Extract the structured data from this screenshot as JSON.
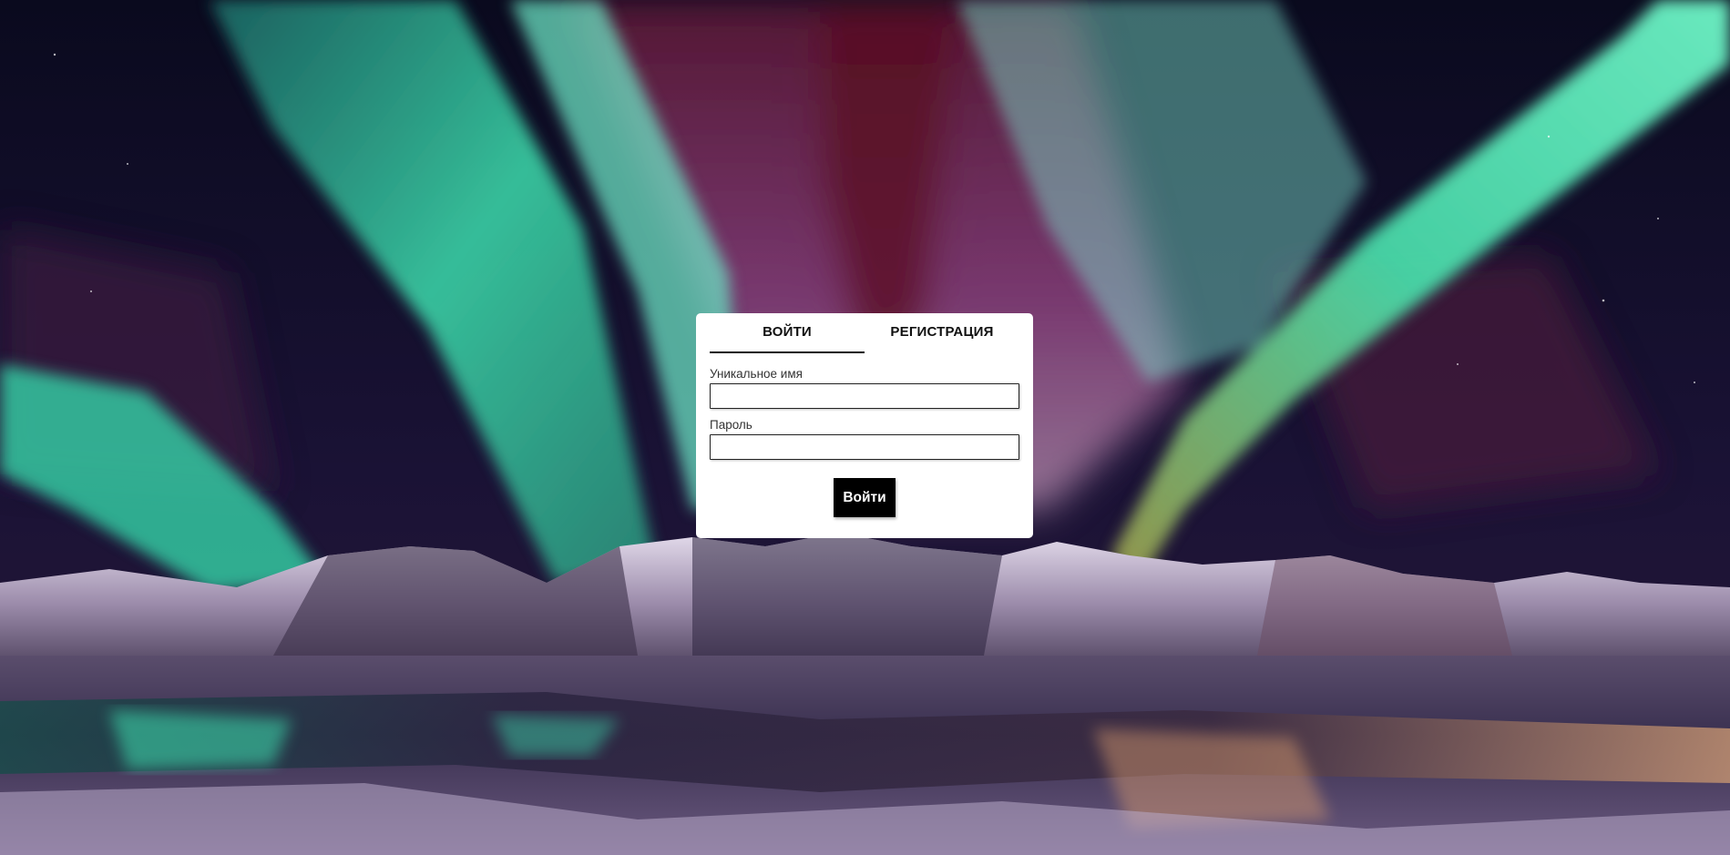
{
  "auth": {
    "tabs": [
      {
        "label": "ВОЙТИ",
        "active": true
      },
      {
        "label": "РЕГИСТРАЦИЯ",
        "active": false
      }
    ],
    "fields": {
      "username_label": "Уникальное имя",
      "username_value": "",
      "password_label": "Пароль",
      "password_value": ""
    },
    "submit_label": "Войти"
  },
  "background": {
    "scene": "aurora-borealis-mountains",
    "colors": {
      "sky": "#0b0b22",
      "aurora_green": "#3fe8b4",
      "aurora_purple": "#8b3e8a",
      "aurora_red": "#6a1a2a",
      "snow": "#d9d3e6"
    }
  }
}
